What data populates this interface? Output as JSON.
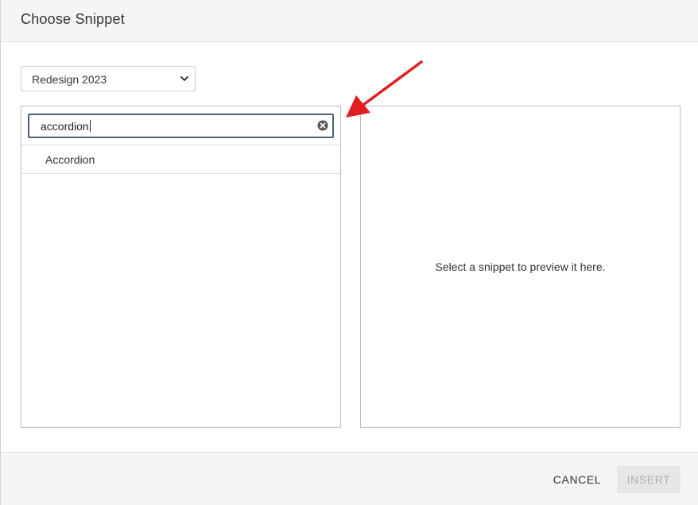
{
  "dialog": {
    "title": "Choose Snippet"
  },
  "snippet_set": {
    "selected": "Redesign 2023"
  },
  "search": {
    "value": "accordion",
    "icon": "clear-icon"
  },
  "results": [
    {
      "label": "Accordion"
    }
  ],
  "preview": {
    "placeholder": "Select a snippet to preview it here."
  },
  "footer": {
    "cancel_label": "CANCEL",
    "insert_label": "INSERT"
  },
  "colors": {
    "annotation_arrow": "#e02020",
    "search_border": "#4a6075",
    "disabled_button_bg": "#e6e6e6"
  }
}
